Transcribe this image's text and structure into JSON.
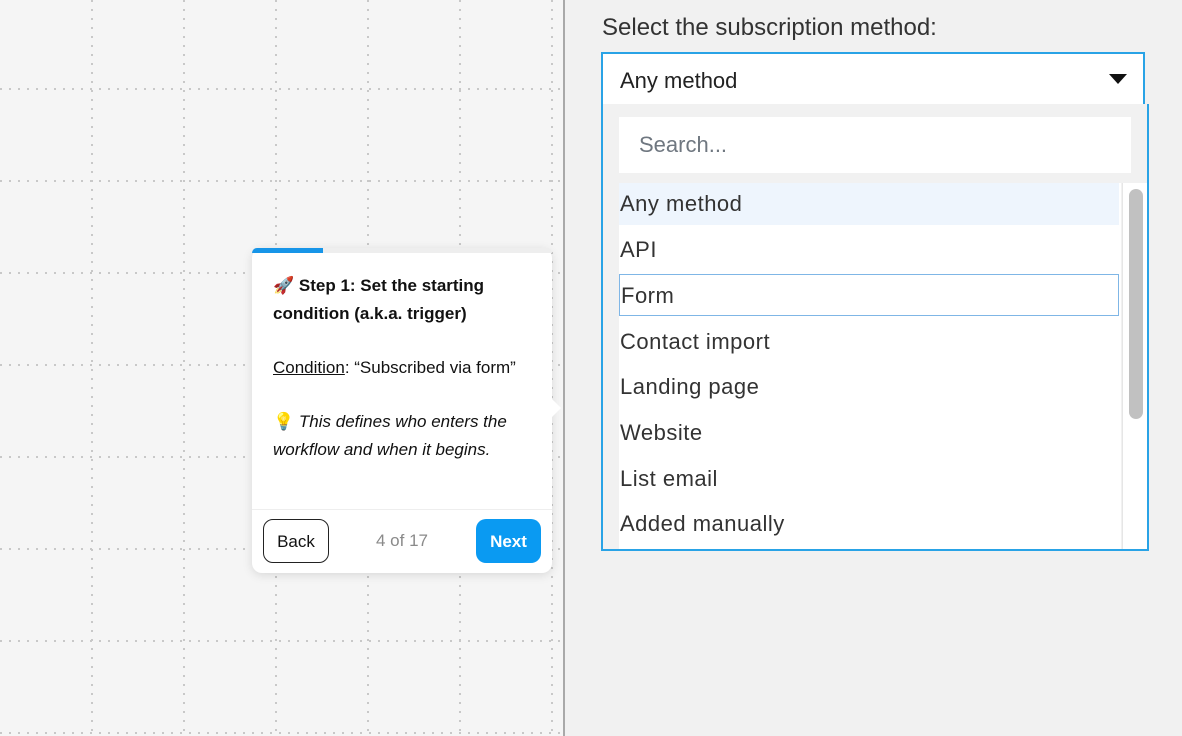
{
  "panel": {
    "label": "Select the subscription method:",
    "select": {
      "value": "Any method",
      "search_placeholder": "Search...",
      "options": [
        {
          "label": "Any method",
          "state": "highlighted"
        },
        {
          "label": "API",
          "state": "normal"
        },
        {
          "label": "Form",
          "state": "focused"
        },
        {
          "label": "Contact import",
          "state": "normal"
        },
        {
          "label": "Landing page",
          "state": "normal"
        },
        {
          "label": "Website",
          "state": "normal"
        },
        {
          "label": "List email",
          "state": "normal"
        },
        {
          "label": "Added manually",
          "state": "normal"
        }
      ]
    }
  },
  "tooltip": {
    "title_icon": "🚀",
    "title": "Step 1: Set the starting condition (a.k.a. trigger)",
    "condition_label": "Condition",
    "condition_text": ": “Subscribed via form”",
    "tip_icon": "💡",
    "tip_text": "This defines who enters the workflow and when it begins.",
    "back_label": "Back",
    "step_counter": "4 of 17",
    "next_label": "Next",
    "progress_fraction": 0.2353
  },
  "colors": {
    "accent": "#29a3e6",
    "next_button": "#0a9af2",
    "progress": "#1795e8",
    "highlight": "#eef5fd"
  },
  "icons": [
    "rocket-icon",
    "lightbulb-icon",
    "caret-down-icon"
  ]
}
